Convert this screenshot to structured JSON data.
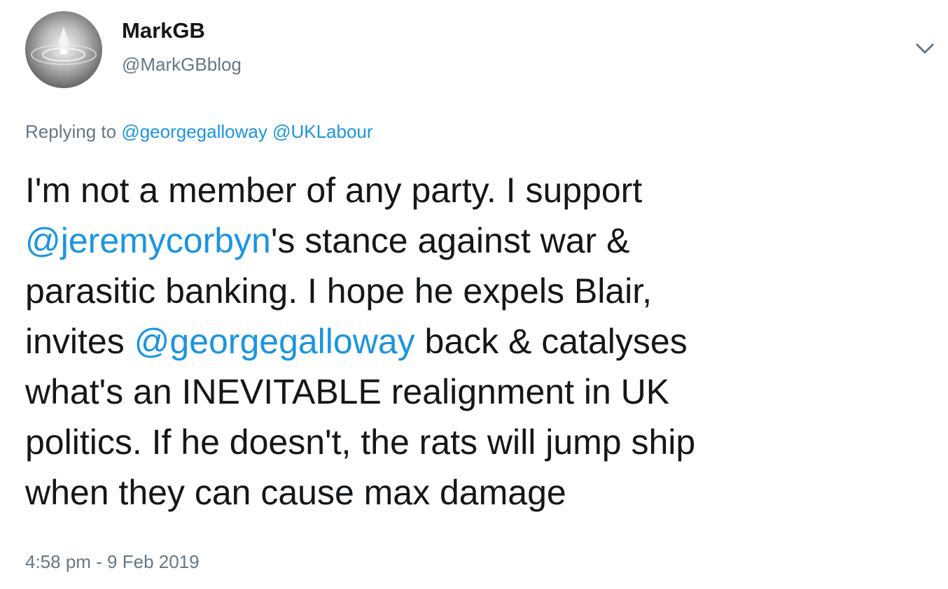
{
  "user": {
    "display_name": "MarkGB",
    "handle": "@MarkGBblog",
    "avatar_icon": "water-drop-avatar"
  },
  "menu": {
    "icon": "chevron-down-icon"
  },
  "reply": {
    "prefix": "Replying to ",
    "mentions": [
      "@georgegalloway",
      "@UKLabour"
    ],
    "separator": " "
  },
  "tweet": {
    "lines": [
      [
        "I'm not a member of any party. I support"
      ],
      [
        "@jeremycorbyn",
        "'s stance against war &"
      ],
      [
        "parasitic banking. I hope he expels Blair,"
      ],
      [
        "invites ",
        "@georgegalloway",
        " back & catalyses"
      ],
      [
        "what's an INEVITABLE realignment in UK"
      ],
      [
        "politics. If he doesn't, the rats will jump ship"
      ],
      [
        "when they can cause max damage"
      ]
    ]
  },
  "timestamp": "4:58 pm - 9 Feb 2019",
  "colors": {
    "link": "#1b95e0",
    "secondary_text": "#657786",
    "primary_text": "#14171a"
  }
}
